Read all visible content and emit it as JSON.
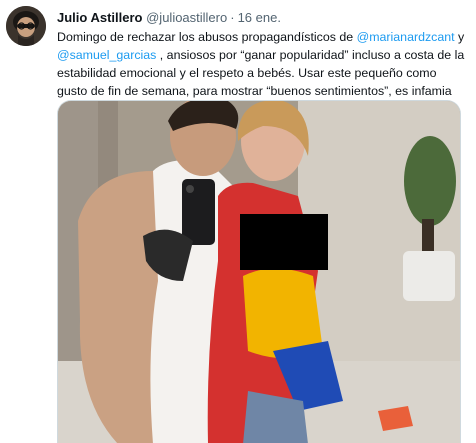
{
  "tweet": {
    "author": {
      "name": "Julio Astillero",
      "handle": "@julioastillero",
      "separator": "·",
      "timestamp": "16 ene."
    },
    "text": {
      "part1": "Domingo de rechazar los abusos propagandísticos de ",
      "mention1": "@marianardzcant",
      "part2": " y ",
      "mention2": "@samuel_garcias",
      "part3": " , ansiosos por “ganar popularidad” incluso a costa de la estabilidad emocional y el respeto a bebés. Usar este pequeño como gusto de fin de semana, para mostrar “buenos sentimientos”, es infamia"
    },
    "media": {
      "icon": "photo-image",
      "colors": {
        "wall": "#c9c0b2",
        "censor_box": "#000000",
        "dress": "#d4312f",
        "mention": "#1d9bf0"
      }
    }
  }
}
